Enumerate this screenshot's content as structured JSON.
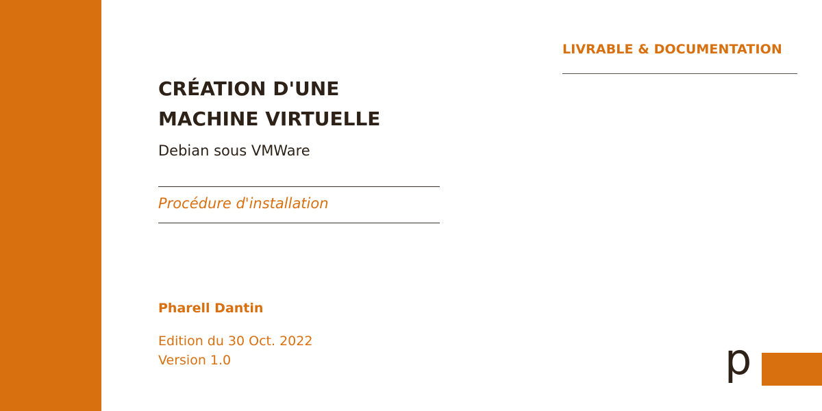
{
  "header": {
    "category": "LIVRABLE & DOCUMENTATION"
  },
  "document": {
    "title_line1": "CRÉATION D'UNE",
    "title_line2": "MACHINE VIRTUELLE",
    "subtitle": "Debian sous VMWare",
    "doc_type": "Procédure d'installation"
  },
  "footer": {
    "author": "Pharell Dantin",
    "edition": "Edition du 30 Oct. 2022",
    "version": "Version 1.0"
  },
  "logo": {
    "letter": "p"
  },
  "colors": {
    "accent": "#D87010",
    "text_dark": "#2E2218",
    "background": "#FFFFFF"
  }
}
